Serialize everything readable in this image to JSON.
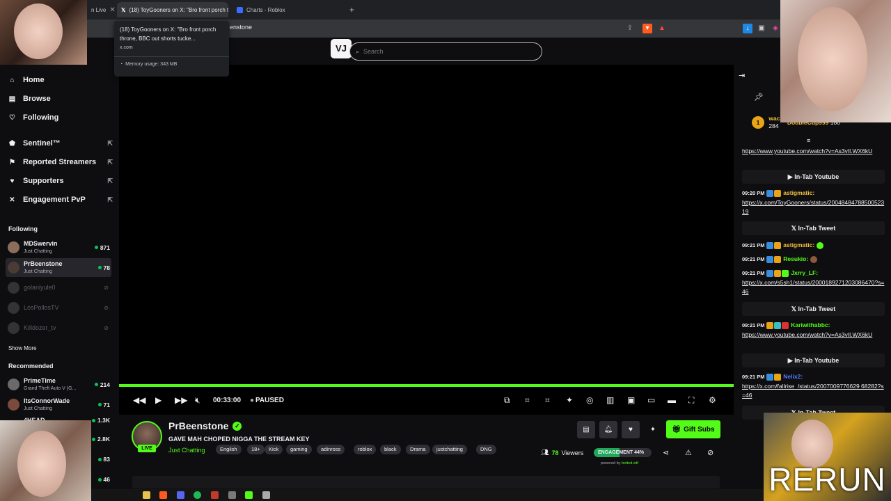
{
  "browser": {
    "tabs": [
      {
        "label": "n Live"
      },
      {
        "label": "(18) ToyGooners on X: \"Bro front porch throne..."
      },
      {
        "label": "Charts - Roblox"
      }
    ],
    "url_fragment": "enstone",
    "new_tab": "+"
  },
  "tooltip": {
    "title": "(18) ToyGooners on X: \"Bro front porch throne, BBC out shorts tucke...",
    "domain": "x.com",
    "memory": "Memory usage: 343 MB"
  },
  "search": {
    "placeholder": "Search",
    "logo": "VJ"
  },
  "sidebar": {
    "nav": [
      {
        "label": "Home",
        "icon": "home-icon"
      },
      {
        "label": "Browse",
        "icon": "browse-icon"
      },
      {
        "label": "Following",
        "icon": "heart-icon"
      }
    ],
    "tools": [
      {
        "label": "Sentinel™",
        "icon": "shield-icon"
      },
      {
        "label": "Reported Streamers",
        "icon": "flag-icon"
      },
      {
        "label": "Supporters",
        "icon": "heart-icon"
      },
      {
        "label": "Engagement PvP",
        "icon": "pvp-icon"
      }
    ],
    "following_header": "Following",
    "following": [
      {
        "name": "MDSwervin",
        "category": "Just Chatting",
        "viewers": "871"
      },
      {
        "name": "PrBeenstone",
        "category": "Just Chatting",
        "viewers": "78"
      },
      {
        "name": "golaniyule0"
      },
      {
        "name": "LosPollosTV"
      },
      {
        "name": "Killdozer_tv"
      }
    ],
    "show_more": "Show More",
    "recommended_header": "Recommended",
    "recommended": [
      {
        "name": "PrimeTime",
        "category": "Grand Theft Auto V (G...",
        "viewers": "214"
      },
      {
        "name": "ItsConnorWade",
        "category": "Just Chatting",
        "viewers": "71"
      },
      {
        "name": "4HEAD",
        "viewers": "1.3K"
      },
      {
        "viewers": "2.8K"
      },
      {
        "viewers": "83"
      },
      {
        "viewers": "46"
      }
    ]
  },
  "player": {
    "time": "00:33:00",
    "status": "PAUSED",
    "progress": 1.0
  },
  "stream": {
    "streamer": "PrBeenstone",
    "live": "LIVE",
    "title": "GAVE MAH CHOPED NIGGA THE STREAM KEY",
    "category": "Just Chatting",
    "tags": [
      "English",
      "18+",
      "Kick",
      "gaming",
      "adinross",
      "roblox",
      "black",
      "Drama",
      "justchatting",
      "DNG"
    ],
    "gift_label": "Gift Subs",
    "viewers_count": "78",
    "viewers_label": "Viewers",
    "engagement_label": "ENGAGEMENT 44%",
    "engagement_value": 0.44,
    "powered_prefix": "powered by",
    "powered_brand": "botted.wtf"
  },
  "chat": {
    "leader": {
      "rank": "1",
      "name1": "wac",
      "count1": "284",
      "name2": "DoubleCup999",
      "count2": "186"
    },
    "messages": [
      {
        "link": "https://www.youtube.com/watch?v=As3vIl.WX6kU"
      },
      {
        "intab": "In-Tab Youtube"
      },
      {
        "time": "09:20 PM",
        "user": "astigmatic:",
        "color": "#f0c040",
        "link": "https://x.com/ToyGooners/status/2004848478850052319"
      },
      {
        "intab": "In-Tab Tweet"
      },
      {
        "time": "09:21 PM",
        "user": "astigmatic:",
        "color": "#f0c040"
      },
      {
        "time": "09:21 PM",
        "user": "Resukio:",
        "color": "#53fc18"
      },
      {
        "time": "09:21 PM",
        "user": "Jxrry_LF:",
        "color": "#53fc18",
        "link": "https://x.com/s5sh1/status/2000189271203086470?s=46"
      },
      {
        "intab": "In-Tab Tweet"
      },
      {
        "time": "09:21 PM",
        "user": "Kariwithabbc:",
        "color": "#53fc18",
        "link": "https://www.youtube.com/watch?v=As3vIl.WX6kU"
      },
      {
        "intab": "In-Tab Youtube"
      },
      {
        "time": "09:21 PM",
        "user": "Nelix2:",
        "color": "#4f7cff",
        "link": "https://x.com/fallrise_/status/2007009776629 68282?s=46"
      },
      {
        "intab": "In-Tab Tweet"
      }
    ]
  },
  "overlay": {
    "rerun": "RERUN"
  },
  "colors": {
    "accent": "#53fc18",
    "bg": "#0e0e10"
  }
}
